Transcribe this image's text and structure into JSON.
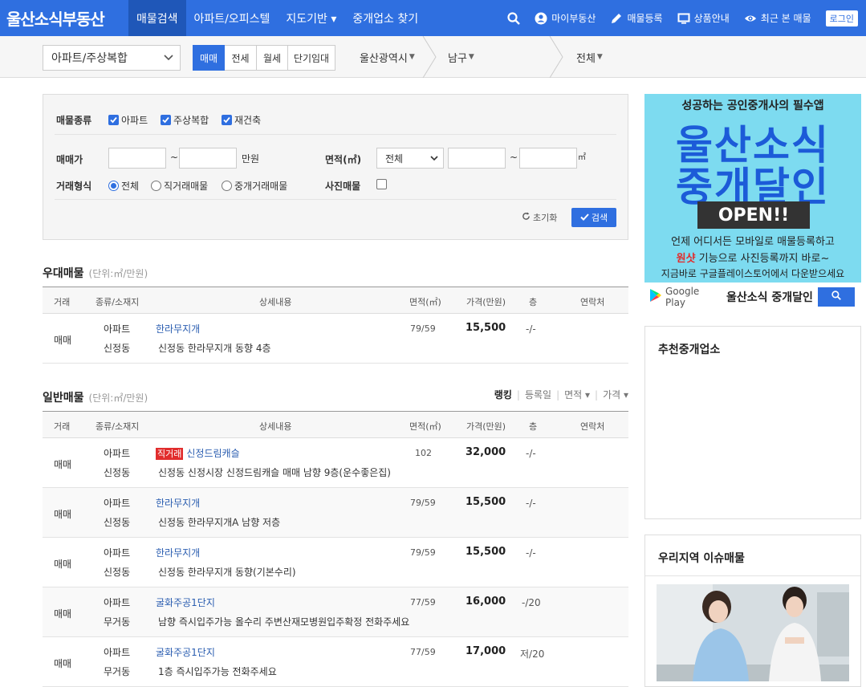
{
  "brand": {
    "logo": "울산소식부동산"
  },
  "nav": {
    "items": [
      {
        "label": "매물검색",
        "active": true
      },
      {
        "label": "아파트/오피스텔",
        "active": false
      },
      {
        "label": "지도기반 ▾",
        "active": false
      },
      {
        "label": "중개업소 찾기",
        "active": false
      }
    ],
    "utils": [
      {
        "label": "마이부동산",
        "icon": "user-icon"
      },
      {
        "label": "매물등록",
        "icon": "pencil-icon"
      },
      {
        "label": "상품안내",
        "icon": "monitor-icon"
      },
      {
        "label": "최근 본 매물",
        "icon": "eye-icon"
      }
    ],
    "login": "로그인"
  },
  "filterbar": {
    "type_select": "아파트/주상복합",
    "deal_types": [
      "매매",
      "전세",
      "월세",
      "단기임대"
    ],
    "selected_deal": "매매",
    "city": "울산광역시",
    "district": "남구",
    "dong": "전체"
  },
  "search": {
    "kind_label": "매물종류",
    "kinds": [
      "아파트",
      "주상복합",
      "재건축"
    ],
    "price_label": "매매가",
    "tilde": "~",
    "price_unit": "만원",
    "area_label": "면적(㎡)",
    "area_select": "전체",
    "area_unit": "㎡",
    "trade_label": "거래형식",
    "trade_options": [
      "전체",
      "직거래매물",
      "중개거래매물"
    ],
    "photo_label": "사진매물",
    "reset_label": "초기화",
    "search_label": "검색"
  },
  "premium": {
    "title": "우대매물",
    "unit": "(단위:㎡/만원)",
    "headers": [
      "거래",
      "종류/소재지",
      "상세내용",
      "면적(㎡)",
      "가격(만원)",
      "층",
      "연락처"
    ],
    "rows": [
      {
        "deal": "매매",
        "kind": "아파트",
        "loc": "신정동",
        "name": "한라무지개",
        "tag": "",
        "desc": "신정동 한라무지개 동향 4층",
        "area": "79/59",
        "price": "15,500",
        "floor": "-/-"
      }
    ]
  },
  "general": {
    "title": "일반매물",
    "unit": "(단위:㎡/만원)",
    "sort": {
      "rank": "랭킹",
      "date": "등록일",
      "area": "면적 ▾",
      "price": "가격 ▾"
    },
    "headers": [
      "거래",
      "종류/소재지",
      "상세내용",
      "면적(㎡)",
      "가격(만원)",
      "층",
      "연락처"
    ],
    "rows": [
      {
        "deal": "매매",
        "kind": "아파트",
        "loc": "신정동",
        "name": "신정드림캐슬",
        "tag": "직거래",
        "desc": "신정동 신정시장 신정드림캐슬 매매 남향 9층(운수좋은집)",
        "area": "102",
        "price": "32,000",
        "floor": "-/-"
      },
      {
        "deal": "매매",
        "kind": "아파트",
        "loc": "신정동",
        "name": "한라무지개",
        "tag": "",
        "desc": "신정동 한라무지개A 남향 저층",
        "area": "79/59",
        "price": "15,500",
        "floor": "-/-"
      },
      {
        "deal": "매매",
        "kind": "아파트",
        "loc": "신정동",
        "name": "한라무지개",
        "tag": "",
        "desc": "신정동 한라무지개 동향(기본수리)",
        "area": "79/59",
        "price": "15,500",
        "floor": "-/-"
      },
      {
        "deal": "매매",
        "kind": "아파트",
        "loc": "무거동",
        "name": "굴화주공1단지",
        "tag": "",
        "desc": "남향 즉시입주가능 올수리 주변산재모병원입주확정 전화주세요",
        "area": "77/59",
        "price": "16,000",
        "floor": "-/20"
      },
      {
        "deal": "매매",
        "kind": "아파트",
        "loc": "무거동",
        "name": "굴화주공1단지",
        "tag": "",
        "desc": "1층 즉시입주가능 전화주세요",
        "area": "77/59",
        "price": "17,000",
        "floor": "저/20"
      }
    ]
  },
  "ad": {
    "top": "성공하는 공인중개사의 필수앱",
    "big1": "울산소식",
    "big2": "중개달인",
    "open": "OPEN!!",
    "line1": "언제 어디서든 모바일로 매물등록하고",
    "line2_red": "원샷",
    "line2_rest": " 기능으로 사진등록까지 바로~",
    "line3": "지금바로 구글플레이스토어에서 다운받으세요",
    "store": "Google Play",
    "search_text": "울산소식 중개달인"
  },
  "panels": {
    "recommend": "추천중개업소",
    "issue": "우리지역 이슈매물"
  }
}
